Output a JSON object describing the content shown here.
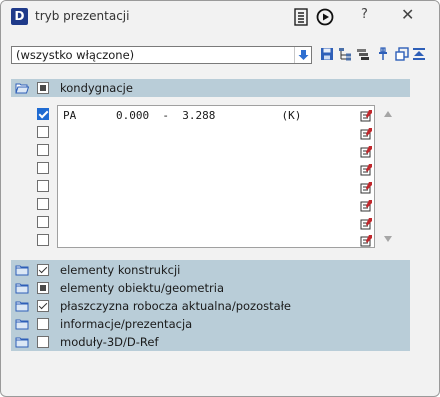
{
  "window": {
    "title": "tryb prezentacji"
  },
  "titlebar": {
    "logo_letter": "D",
    "help_label": "?",
    "close_label": "✕"
  },
  "filter": {
    "value": "(wszystko włączone)"
  },
  "kondygnacje": {
    "label": "kondygnacje",
    "rows": [
      {
        "checked": true,
        "text": "PA      0.000  -  3.288          (K)"
      },
      {
        "checked": false,
        "text": ""
      },
      {
        "checked": false,
        "text": ""
      },
      {
        "checked": false,
        "text": ""
      },
      {
        "checked": false,
        "text": ""
      },
      {
        "checked": false,
        "text": ""
      },
      {
        "checked": false,
        "text": ""
      },
      {
        "checked": false,
        "text": ""
      }
    ]
  },
  "groups": [
    {
      "label": "elementy konstrukcji",
      "state": "ticked"
    },
    {
      "label": "elementy obiektu/geometria",
      "state": "filled"
    },
    {
      "label": "płaszczyzna robocza aktualna/pozostałe",
      "state": "ticked"
    },
    {
      "label": "informacje/prezentacja",
      "state": "empty"
    },
    {
      "label": "moduły-3D/D-Ref",
      "state": "empty"
    }
  ],
  "colors": {
    "group_bg": "#b9cdd8",
    "accent": "#1f6bd2"
  }
}
